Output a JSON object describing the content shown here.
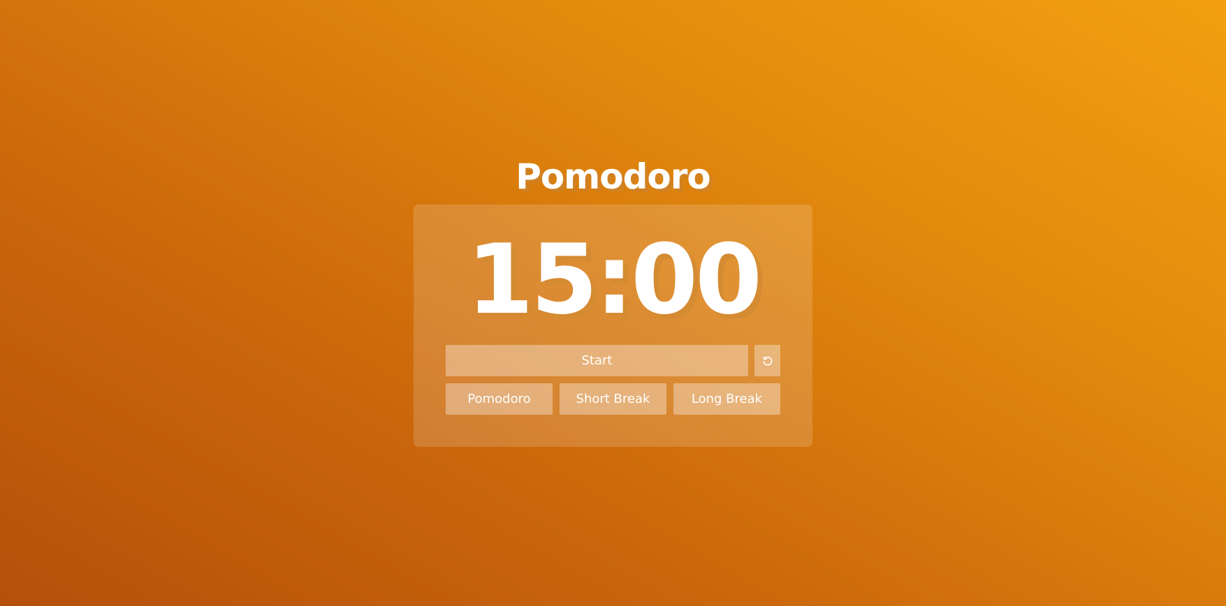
{
  "app": {
    "title": "Pomodoro"
  },
  "timer": {
    "display": "15:00"
  },
  "controls": {
    "start_label": "Start",
    "reset_icon": "reset-icon"
  },
  "modes": [
    {
      "label": "Pomodoro"
    },
    {
      "label": "Short Break"
    },
    {
      "label": "Long Break"
    }
  ],
  "colors": {
    "background_start": "#b4500a",
    "background_end": "#f29f10",
    "text": "#ffffff"
  }
}
